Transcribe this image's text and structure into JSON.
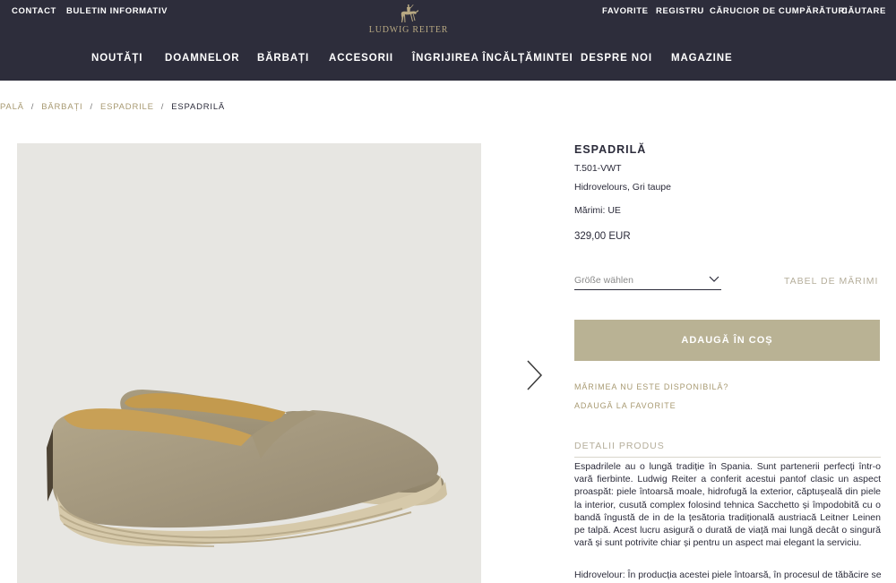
{
  "header": {
    "top_left": [
      "CONTACT",
      "BULETIN INFORMATIV"
    ],
    "top_right": [
      "FAVORITE",
      "REGISTRU",
      "CĂRUCIOR DE CUMPĂRĂTURI",
      "CĂUTARE"
    ],
    "logo_text": "LUDWIG REITER",
    "nav": [
      "NOUTĂȚI",
      "DOAMNELOR",
      "BĂRBAȚI",
      "ACCESORII",
      "ÎNGRIJIREA ÎNCĂLȚĂMINTEI",
      "DESPRE NOI",
      "MAGAZINE"
    ]
  },
  "breadcrumb": {
    "items": [
      "PALĂ",
      "BĂRBAȚI",
      "ESPADRILE"
    ],
    "current": "ESPADRILĂ",
    "separator": "/"
  },
  "product": {
    "title": "ESPADRILĂ",
    "sku": "T.501-VWT",
    "material": "Hidrovelours, Gri taupe",
    "sizes": "Mărimi: UE",
    "price": "329,00 EUR",
    "size_placeholder": "Größe wählen",
    "size_table": "TABEL DE MĂRIMI",
    "add_to_cart": "ADAUGĂ ÎN COȘ",
    "size_unavailable": "MĂRIMEA NU ESTE DISPONIBILĂ?",
    "add_favorite": "ADAUGĂ LA FAVORITE",
    "details_heading": "DETALII PRODUS",
    "description": "Espadrilele au o lungă tradiție în Spania. Sunt partenerii perfecți într-o vară fierbinte. Ludwig Reiter a conferit acestui pantof clasic un aspect proaspăt: piele întoarsă moale, hidrofugă la exterior, căptușeală din piele la interior, cusută complex folosind tehnica Sacchetto și împodobită cu o bandă îngustă de in de la țesătoria tradițională austriacă Leitner Leinen pe talpă. Acest lucru asigură o durată de viață mai lungă decât o singură vară și sunt potrivite chiar și pentru un aspect mai elegant la serviciu.",
    "description2": "Hidrovelour: În producția acestei piele întoarsă, în procesul de tăbăcire se"
  },
  "colors": {
    "header_bg": "#2d2d3b",
    "accent_gold": "#b9b294",
    "link_gold": "#a89a72",
    "image_bg": "#e7e6e2"
  }
}
